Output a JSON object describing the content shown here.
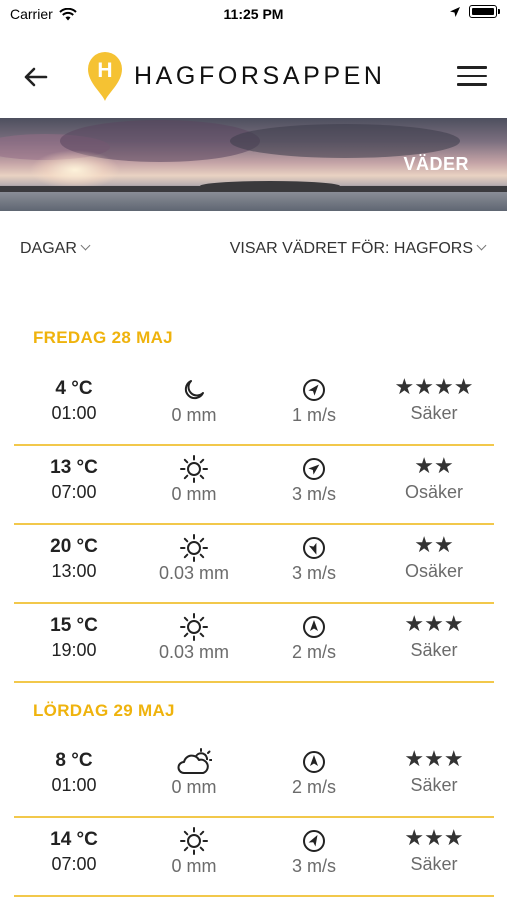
{
  "status_bar": {
    "carrier": "Carrier",
    "time": "11:25 PM"
  },
  "app": {
    "title": "HAGFORSAPPEN",
    "logo_letter": "H"
  },
  "hero": {
    "label": "VÄDER"
  },
  "filters": {
    "days_label": "DAGAR",
    "location_label": "VISAR VÄDRET FÖR: HAGFORS"
  },
  "colors": {
    "accent": "#efb30d",
    "divider": "#f2c84b"
  },
  "days": [
    {
      "header": "FREDAG 28 MAJ",
      "rows": [
        {
          "temp": "4 °C",
          "time": "01:00",
          "icon": "moon-icon",
          "precip": "0 mm",
          "wind": "1 m/s",
          "wind_dir_deg": 40,
          "stars": "★★★★",
          "reliability": "Säker"
        },
        {
          "temp": "13 °C",
          "time": "07:00",
          "icon": "sun-icon",
          "precip": "0 mm",
          "wind": "3 m/s",
          "wind_dir_deg": 50,
          "stars": "★★",
          "reliability": "Osäker"
        },
        {
          "temp": "20 °C",
          "time": "13:00",
          "icon": "sun-icon",
          "precip": "0.03 mm",
          "wind": "3 m/s",
          "wind_dir_deg": 160,
          "stars": "★★",
          "reliability": "Osäker"
        },
        {
          "temp": "15 °C",
          "time": "19:00",
          "icon": "sun-icon",
          "precip": "0.03 mm",
          "wind": "2 m/s",
          "wind_dir_deg": 0,
          "stars": "★★★",
          "reliability": "Säker"
        }
      ]
    },
    {
      "header": "LÖRDAG 29 MAJ",
      "rows": [
        {
          "temp": "8 °C",
          "time": "01:00",
          "icon": "cloud-icon",
          "precip": "0 mm",
          "wind": "2 m/s",
          "wind_dir_deg": 0,
          "stars": "★★★",
          "reliability": "Säker"
        },
        {
          "temp": "14 °C",
          "time": "07:00",
          "icon": "sun-icon",
          "precip": "0 mm",
          "wind": "3 m/s",
          "wind_dir_deg": 30,
          "stars": "★★★",
          "reliability": "Säker"
        }
      ]
    }
  ]
}
